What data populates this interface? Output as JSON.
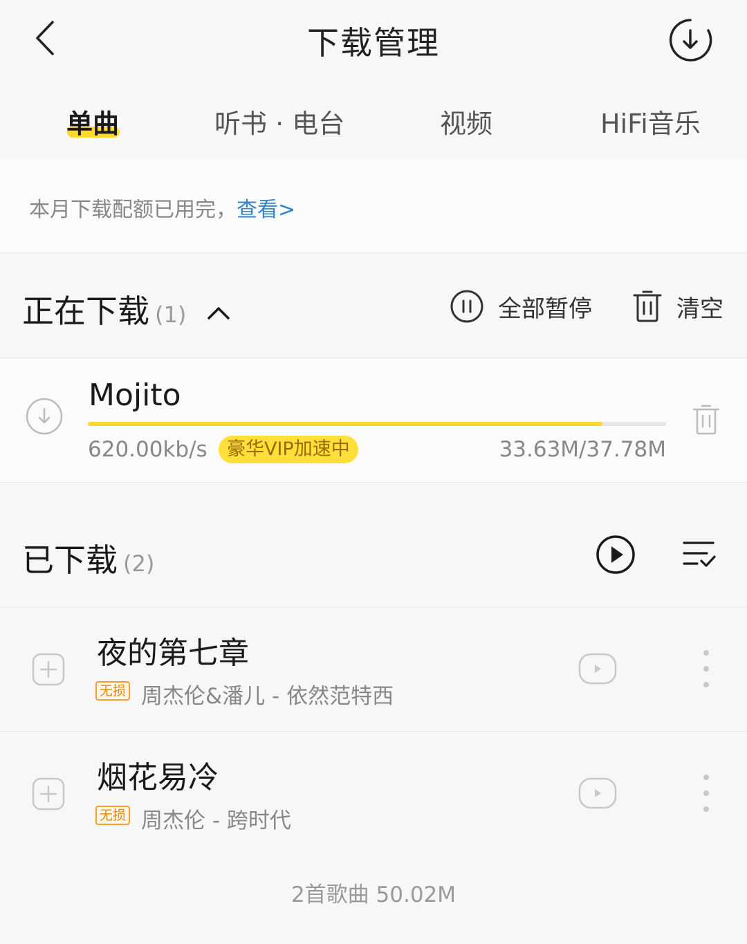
{
  "header": {
    "title": "下载管理",
    "back_icon": "chevron-left-icon",
    "download_icon": "download-circle-icon"
  },
  "tabs": [
    {
      "label": "单曲",
      "active": true
    },
    {
      "label": "听书 · 电台",
      "active": false
    },
    {
      "label": "视频",
      "active": false
    },
    {
      "label": "HiFi音乐",
      "active": false
    }
  ],
  "quota": {
    "text": "本月下载配额已用完，",
    "link": "查看>"
  },
  "downloading": {
    "title": "正在下载",
    "count": "(1)",
    "pause_all": "全部暂停",
    "clear": "清空",
    "items": [
      {
        "name": "Mojito",
        "speed": "620.00kb/s",
        "badge": "豪华VIP加速中",
        "size": "33.63M/37.78M",
        "progress": 0.89
      }
    ]
  },
  "downloaded": {
    "title": "已下载",
    "count": "(2)",
    "items": [
      {
        "title": "夜的第七章",
        "quality": "无损",
        "artist": "周杰伦&潘儿 - 依然范特西"
      },
      {
        "title": "烟花易冷",
        "quality": "无损",
        "artist": "周杰伦 - 跨时代"
      }
    ]
  },
  "footer": "2首歌曲 50.02M",
  "colors": {
    "accent": "#ffd92f",
    "link": "#2f85d0",
    "badge_text": "#9a6a00",
    "lossless": "#e08a10"
  }
}
